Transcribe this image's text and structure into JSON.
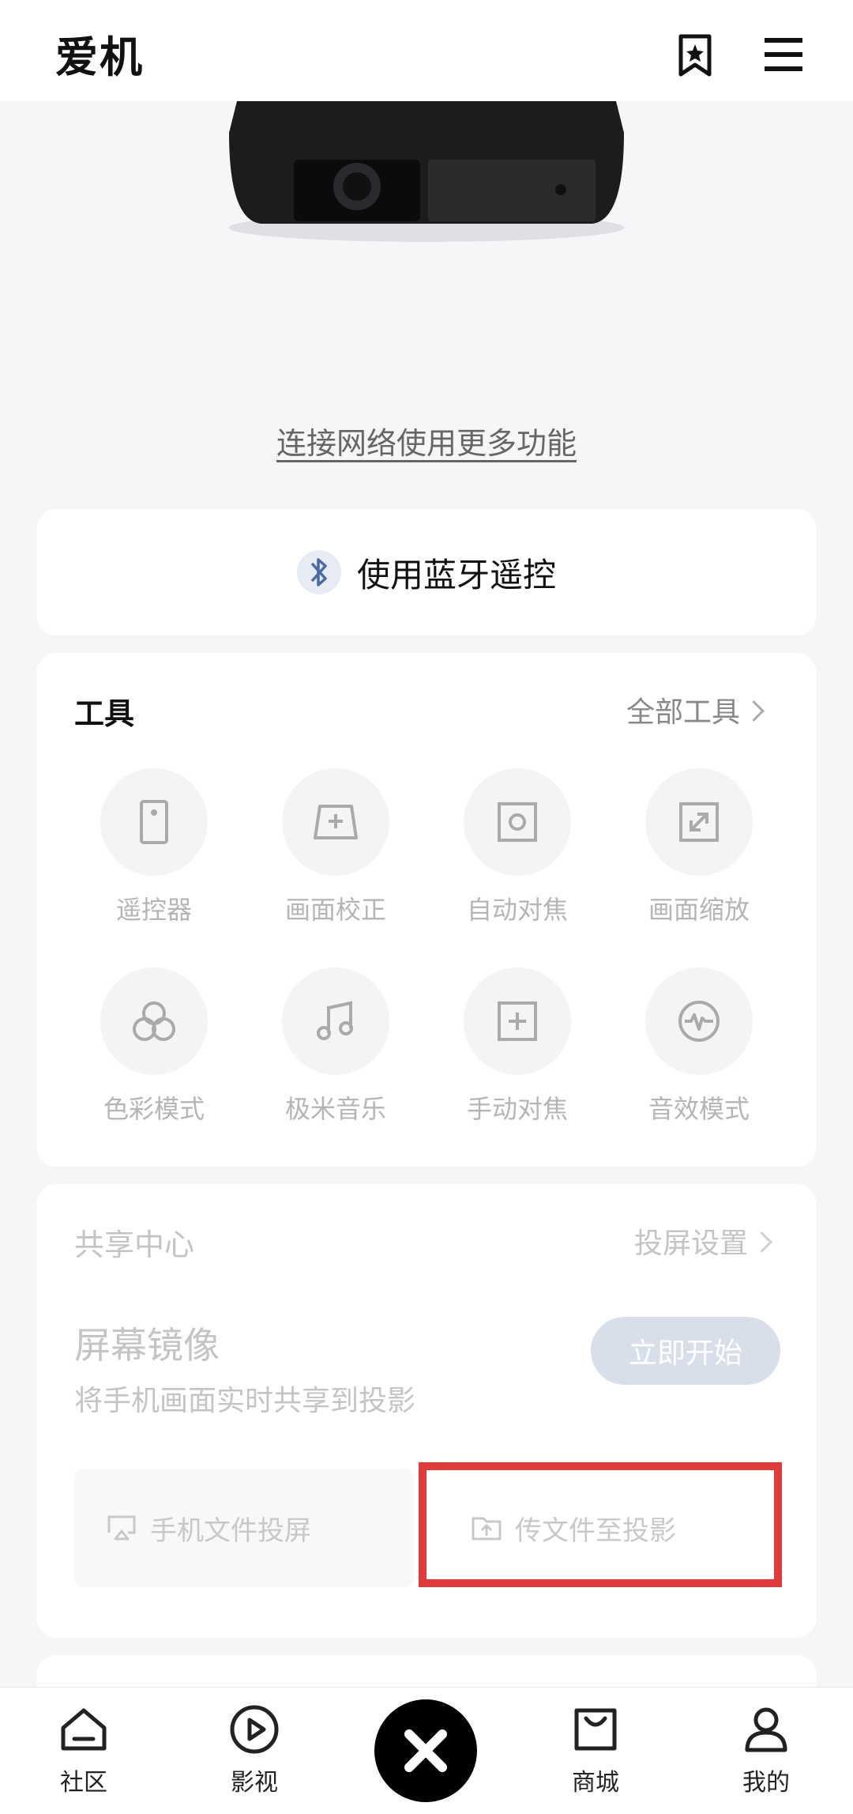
{
  "header": {
    "title": "爱机",
    "bookmark_icon": "bookmark-star-icon",
    "menu_icon": "menu-icon"
  },
  "hero": {
    "image_desc": "projector",
    "link_text": "连接网络使用更多功能"
  },
  "bluetooth": {
    "label": "使用蓝牙遥控",
    "icon": "bluetooth-icon"
  },
  "tools": {
    "title": "工具",
    "all_label": "全部工具",
    "items": [
      {
        "label": "遥控器",
        "icon": "remote-icon"
      },
      {
        "label": "画面校正",
        "icon": "keystone-icon"
      },
      {
        "label": "自动对焦",
        "icon": "autofocus-icon"
      },
      {
        "label": "画面缩放",
        "icon": "zoom-icon"
      },
      {
        "label": "色彩模式",
        "icon": "color-mode-icon"
      },
      {
        "label": "极米音乐",
        "icon": "music-icon"
      },
      {
        "label": "手动对焦",
        "icon": "manual-focus-icon"
      },
      {
        "label": "音效模式",
        "icon": "sound-effect-icon"
      }
    ]
  },
  "share": {
    "title": "共享中心",
    "setting_label": "投屏设置",
    "mirror_title": "屏幕镜像",
    "mirror_desc": "将手机画面实时共享到投影",
    "start_label": "立即开始",
    "file_cast_label": "手机文件投屏",
    "file_transfer_label": "传文件至投影"
  },
  "nav": {
    "items": [
      {
        "label": "社区",
        "icon": "home-icon"
      },
      {
        "label": "影视",
        "icon": "play-icon"
      },
      {
        "label": "",
        "icon": "xgimi-logo-icon"
      },
      {
        "label": "商城",
        "icon": "shop-bag-icon"
      },
      {
        "label": "我的",
        "icon": "profile-icon"
      }
    ]
  },
  "colors": {
    "highlight": "#e03b3b",
    "start_button": "#d8dfea",
    "bluetooth": "#4a6aa8"
  }
}
